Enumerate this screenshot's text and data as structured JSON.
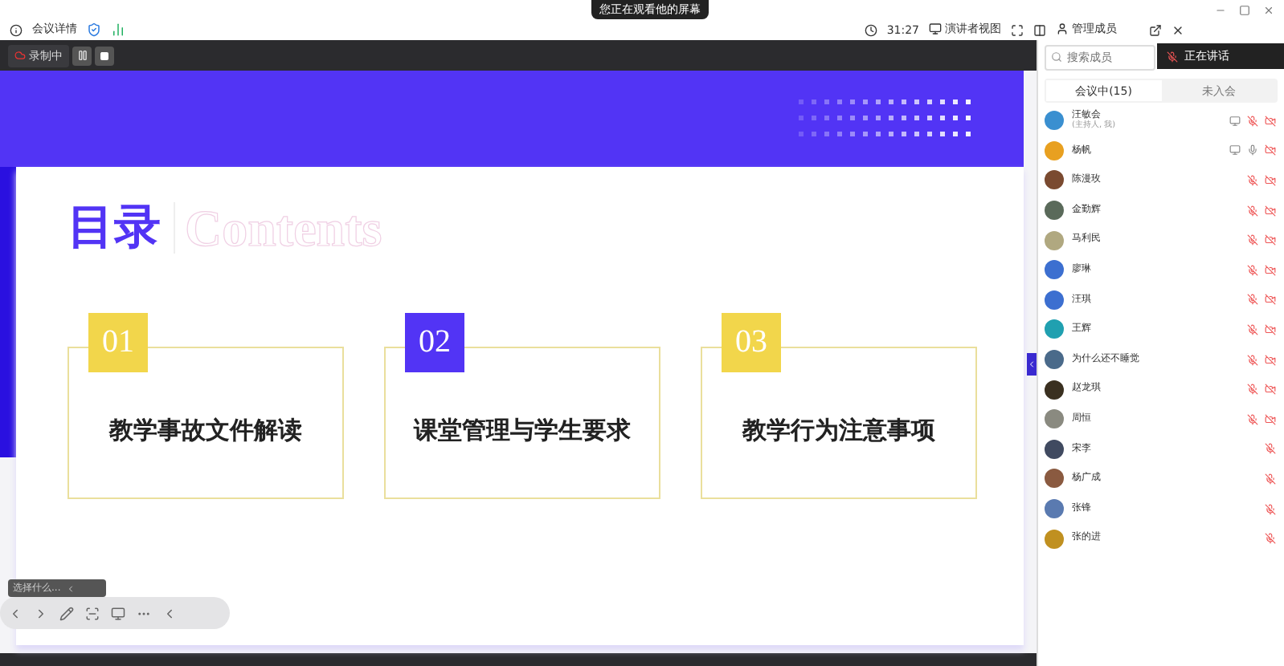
{
  "notice": "您正在观看他的屏幕",
  "header": {
    "meeting_info": "会议详情",
    "timer": "31:27",
    "view": "演讲者视图",
    "manage": "管理成员"
  },
  "recording": {
    "label": "录制中",
    "paused": false
  },
  "slide": {
    "title": "目录",
    "subtitle": "Contents",
    "items": [
      {
        "number": "01",
        "text": "教学事故文件解读",
        "color": "#f2d64b"
      },
      {
        "number": "02",
        "text": "课堂管理与学生要求",
        "color": "#5234f5"
      },
      {
        "number": "03",
        "text": "教学行为注意事项",
        "color": "#f2d64b"
      }
    ]
  },
  "pen_label": "选择什么...",
  "panel": {
    "search": {
      "placeholder": "搜索成员"
    },
    "speaking": "正在讲话",
    "tabs": [
      {
        "label": "会议中(15)",
        "selected": true
      },
      {
        "label": "未入会",
        "selected": false
      }
    ],
    "members": [
      {
        "name": "汪敏会",
        "role": "(主持人, 我)",
        "color": "#3a8fd0",
        "muted": true,
        "camera_off": true,
        "sharing": true
      },
      {
        "name": "杨帆",
        "color": "#e8a020",
        "muted": false,
        "camera_off": true,
        "sharing": true
      },
      {
        "name": "陈漫玫",
        "color": "#7a4a30",
        "muted": true,
        "camera_off": true,
        "sharing": false
      },
      {
        "name": "金勤辉",
        "color": "#5a6a5a",
        "muted": true,
        "camera_off": true,
        "sharing": false
      },
      {
        "name": "马利民",
        "color": "#b0a880",
        "muted": true,
        "camera_off": true,
        "sharing": false
      },
      {
        "name": "廖琳",
        "color": "#3c6fd0",
        "muted": true,
        "camera_off": true,
        "sharing": false
      },
      {
        "name": "汪琪",
        "color": "#3c6fd0",
        "muted": true,
        "camera_off": true,
        "sharing": false
      },
      {
        "name": "王辉",
        "color": "#20a0b0",
        "muted": true,
        "camera_off": true,
        "sharing": false
      },
      {
        "name": "为什么还不睡觉",
        "color": "#4a6a8a",
        "muted": true,
        "camera_off": true,
        "sharing": false
      },
      {
        "name": "赵龙琪",
        "color": "#3a3020",
        "muted": true,
        "camera_off": true,
        "sharing": false
      },
      {
        "name": "周恒",
        "color": "#8a8a80",
        "muted": true,
        "camera_off": true,
        "sharing": false
      },
      {
        "name": "宋李",
        "color": "#404a60",
        "muted": true,
        "camera_off": false,
        "sharing": false
      },
      {
        "name": "杨广成",
        "color": "#8a5a40",
        "muted": true,
        "camera_off": false,
        "sharing": false
      },
      {
        "name": "张锋",
        "color": "#5a7ab0",
        "muted": true,
        "camera_off": false,
        "sharing": false
      },
      {
        "name": "张的进",
        "color": "#c09020",
        "muted": true,
        "camera_off": false,
        "sharing": false
      }
    ]
  }
}
